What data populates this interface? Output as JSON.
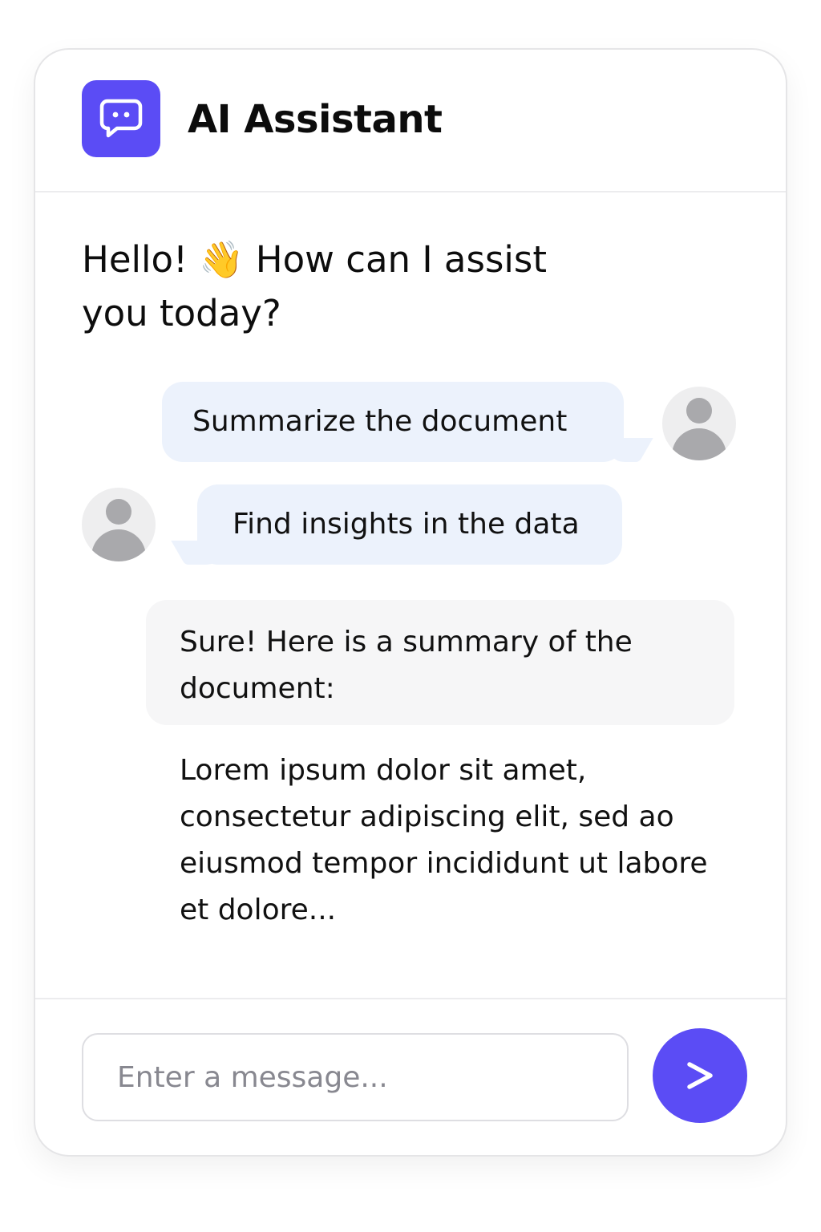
{
  "header": {
    "app_icon": "chat-bubble-icon",
    "title": "AI Assistant"
  },
  "greeting": {
    "text": "Hello! 👋 How can I assist you today?",
    "emoji_icon": "waving-hand-icon"
  },
  "messages": [
    {
      "role": "user",
      "text": "Summarize the document",
      "avatar_icon": "user-avatar-icon",
      "avatar_side": "right"
    },
    {
      "role": "user",
      "text": "Find insights in the data",
      "avatar_icon": "user-avatar-icon",
      "avatar_side": "left"
    },
    {
      "role": "assistant",
      "text": "Sure! Here is a summary of the document:"
    }
  ],
  "summary_text": "Lorem ipsum dolor sit amet, consectetur adipiscing elit, sed ao eiusmod tempor incididunt ut labore et dolore...",
  "composer": {
    "placeholder": "Enter a message...",
    "value": "",
    "send_icon": "send-arrow-icon"
  },
  "colors": {
    "accent": "#5b4cf5",
    "user_bubble": "#ecf2fc",
    "assistant_bubble": "#f6f6f7",
    "avatar_bg": "#eeeeef",
    "avatar_fg": "#a9a9ac"
  }
}
